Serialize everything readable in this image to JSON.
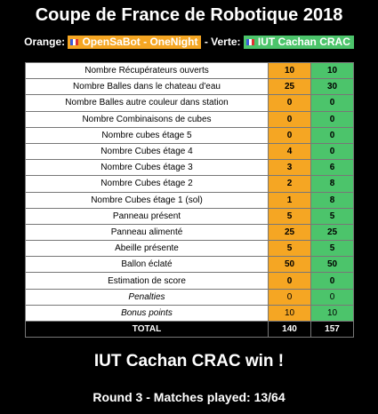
{
  "header": {
    "title": "Coupe de France de Robotique 2018",
    "orange_label": "Orange:",
    "orange_team": "OpenSaBot - OneNight",
    "separator": "-",
    "green_label": "Verte:",
    "green_team": "IUT Cachan CRAC"
  },
  "colors": {
    "orange": "#f5a623",
    "green": "#4cc46b"
  },
  "rows": [
    {
      "label": "Nombre Récupérateurs ouverts",
      "orange": "10",
      "green": "10"
    },
    {
      "label": "Nombre Balles dans le chateau d'eau",
      "orange": "25",
      "green": "30"
    },
    {
      "label": "Nombre Balles autre couleur dans station",
      "orange": "0",
      "green": "0"
    },
    {
      "label": "Nombre Combinaisons de cubes",
      "orange": "0",
      "green": "0"
    },
    {
      "label": "Nombre cubes étage 5",
      "orange": "0",
      "green": "0"
    },
    {
      "label": "Nombre Cubes étage 4",
      "orange": "4",
      "green": "0"
    },
    {
      "label": "Nombre Cubes étage 3",
      "orange": "3",
      "green": "6"
    },
    {
      "label": "Nombre Cubes étage 2",
      "orange": "2",
      "green": "8"
    },
    {
      "label": "Nombre Cubes étage 1 (sol)",
      "orange": "1",
      "green": "8"
    },
    {
      "label": "Panneau présent",
      "orange": "5",
      "green": "5"
    },
    {
      "label": "Panneau alimenté",
      "orange": "25",
      "green": "25"
    },
    {
      "label": "Abeille présente",
      "orange": "5",
      "green": "5"
    },
    {
      "label": "Ballon éclaté",
      "orange": "50",
      "green": "50"
    },
    {
      "label": "Estimation de score",
      "orange": "0",
      "green": "0"
    },
    {
      "label": "Penalties",
      "orange": "0",
      "green": "0"
    },
    {
      "label": "Bonus points",
      "orange": "10",
      "green": "10"
    }
  ],
  "total": {
    "label": "TOTAL",
    "orange": "140",
    "green": "157"
  },
  "winner": "IUT Cachan CRAC win !",
  "round": "Round 3 - Matches played: 13/64"
}
